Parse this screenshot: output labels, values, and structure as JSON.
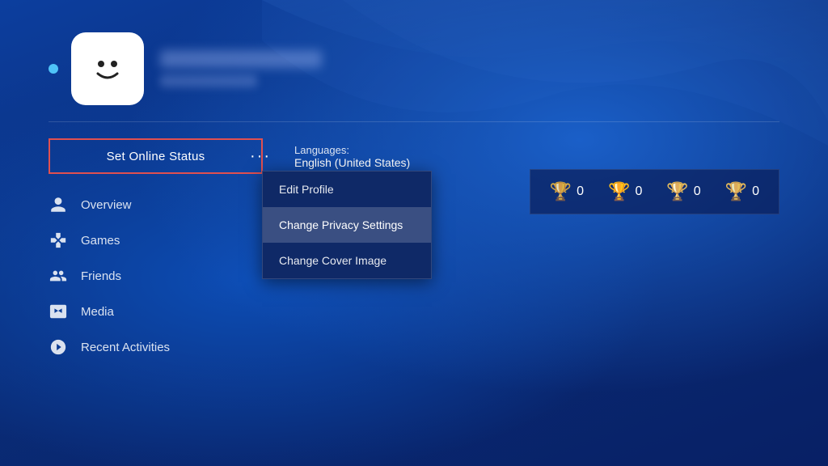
{
  "background": {
    "color1": "#0a3a8a",
    "color2": "#082065"
  },
  "profile": {
    "online_dot_color": "#4fc3f7",
    "avatar_alt": "PlayStation face avatar"
  },
  "set_online_btn": {
    "label": "Set Online Status"
  },
  "dots_button": {
    "label": "···"
  },
  "language": {
    "label": "Languages:",
    "value": "English (United States)"
  },
  "nav": {
    "items": [
      {
        "id": "overview",
        "label": "Overview",
        "icon": "person"
      },
      {
        "id": "games",
        "label": "Games",
        "icon": "gamepad"
      },
      {
        "id": "friends",
        "label": "Friends",
        "icon": "friends"
      },
      {
        "id": "media",
        "label": "Media",
        "icon": "media"
      },
      {
        "id": "recent-activities",
        "label": "Recent Activities",
        "icon": "activities"
      }
    ]
  },
  "dropdown": {
    "items": [
      {
        "id": "edit-profile",
        "label": "Edit Profile",
        "active": false
      },
      {
        "id": "change-privacy-settings",
        "label": "Change Privacy Settings",
        "active": true
      },
      {
        "id": "change-cover-image",
        "label": "Change Cover Image",
        "active": false
      }
    ]
  },
  "trophies": {
    "items": [
      {
        "type": "platinum",
        "color": "#c0c0c0",
        "count": "0",
        "icon": "🏆"
      },
      {
        "type": "gold",
        "color": "#ffd700",
        "count": "0",
        "icon": "🏆"
      },
      {
        "type": "silver",
        "color": "#c0c0c0",
        "count": "0",
        "icon": "🏆"
      },
      {
        "type": "bronze",
        "color": "#cd7f32",
        "count": "0",
        "icon": "🏆"
      }
    ]
  }
}
